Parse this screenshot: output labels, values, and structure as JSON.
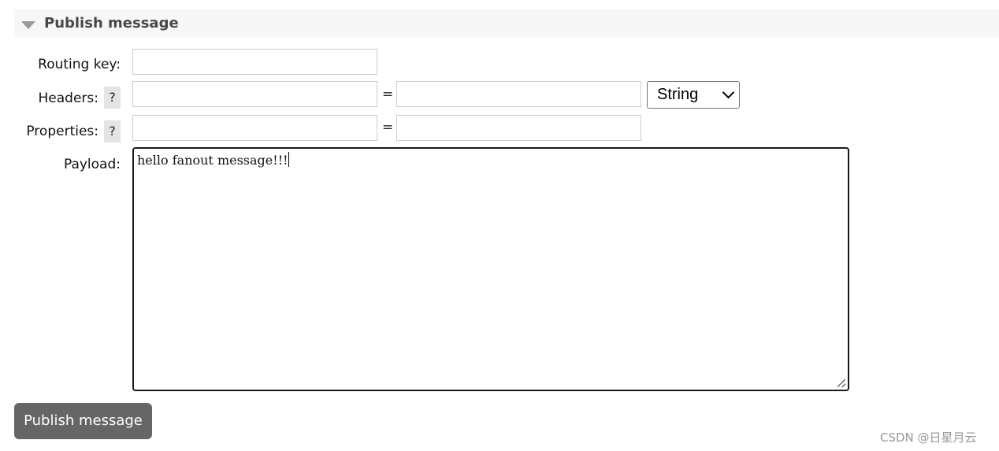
{
  "section": {
    "title": "Publish message",
    "collapse_icon": "triangle-down-icon"
  },
  "form": {
    "routing_key": {
      "label": "Routing key:",
      "value": ""
    },
    "headers": {
      "label": "Headers:",
      "help": "?",
      "key": "",
      "equals": "=",
      "value": "",
      "type": "String"
    },
    "properties": {
      "label": "Properties:",
      "help": "?",
      "key": "",
      "equals": "=",
      "value": ""
    },
    "payload": {
      "label": "Payload:",
      "value": "hello fanout message!!!"
    }
  },
  "publish_button": "Publish message",
  "watermark": "CSDN @日星月云"
}
